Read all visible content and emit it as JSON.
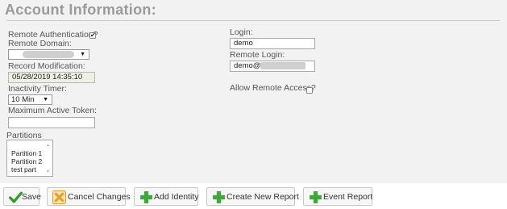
{
  "account": {
    "title": "Account Information:",
    "remote_authentication": {
      "label": "Remote Authentication?",
      "checked": true
    },
    "remote_domain": {
      "label": "Remote Domain:",
      "value": "",
      "arrow": "▼"
    },
    "record_modification": {
      "label": "Record Modification:",
      "value": "05/28/2019 14:35:10"
    },
    "inactivity_timer": {
      "label": "Inactivity Timer:",
      "value": "10 Min",
      "arrow": "▼"
    },
    "maximum_active_token": {
      "label": "Maximum Active Token:",
      "value": ""
    },
    "login": {
      "label": "Login:",
      "value": "demo"
    },
    "remote_login": {
      "label": "Remote Login:",
      "value": "demo@"
    },
    "allow_remote_access": {
      "label": "Allow Remote Access?",
      "checked": false
    },
    "partitions": {
      "label": "Partitions",
      "items": [
        "Partition 1",
        "Partition 2",
        "test part"
      ]
    }
  },
  "buttons": {
    "save": "Save",
    "cancel": "Cancel Changes",
    "add_identity": "Add Identity",
    "create_report": "Create New Report",
    "event_report": "Event Report"
  },
  "colors": {
    "panel_bg": "#f2f2f2",
    "plus_green": "#3ea838",
    "check_green": "#2f9a25",
    "cancel_orange": "#e8a22a"
  },
  "icons": [
    "check-icon",
    "cancel-x-icon",
    "plus-icon"
  ]
}
